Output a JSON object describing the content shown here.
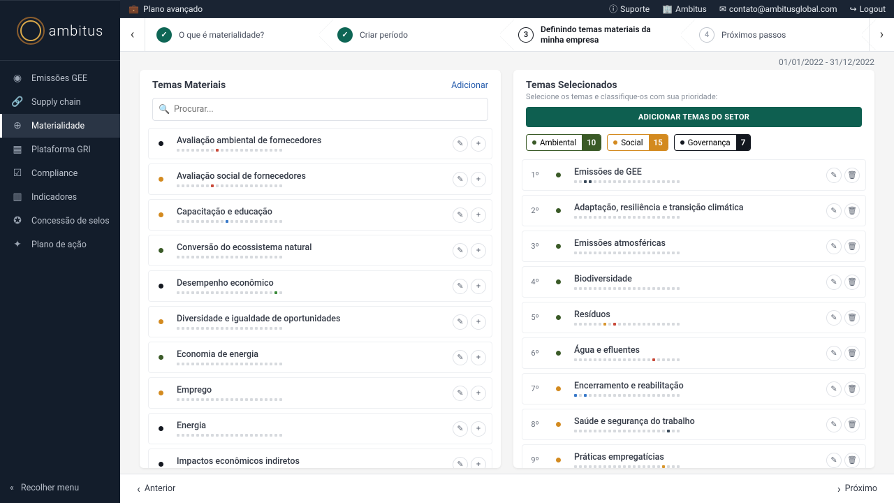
{
  "topbar": {
    "plan": "Plano avançado",
    "support": "Suporte",
    "brand": "Ambitus",
    "email": "contato@ambitusglobal.com",
    "logout": "Logout"
  },
  "logo_text": "ambitus",
  "nav": {
    "items": [
      {
        "label": "Emissões GEE"
      },
      {
        "label": "Supply chain"
      },
      {
        "label": "Materialidade"
      },
      {
        "label": "Plataforma GRI"
      },
      {
        "label": "Compliance"
      },
      {
        "label": "Indicadores"
      },
      {
        "label": "Concessão de selos"
      },
      {
        "label": "Plano de ação"
      }
    ],
    "collapse": "Recolher menu"
  },
  "stepper": {
    "s1": "O que é materialidade?",
    "s2": "Criar período",
    "s3": "Definindo temas materiais da minha empresa",
    "s4": "Próximos passos",
    "n3": "3",
    "n4": "4"
  },
  "date_range": "01/01/2022 - 31/12/2022",
  "left": {
    "title": "Temas Materiais",
    "add": "Adicionar",
    "search_placeholder": "Procurar...",
    "items": [
      {
        "cat": "gov",
        "name": "Avaliação ambiental de fornecedores"
      },
      {
        "cat": "soc",
        "name": "Avaliação social de fornecedores"
      },
      {
        "cat": "soc",
        "name": "Capacitação e educação"
      },
      {
        "cat": "env",
        "name": "Conversão do ecossistema natural"
      },
      {
        "cat": "gov",
        "name": "Desempenho econômico"
      },
      {
        "cat": "soc",
        "name": "Diversidade e igualdade de oportunidades"
      },
      {
        "cat": "env",
        "name": "Economia de energia"
      },
      {
        "cat": "soc",
        "name": "Emprego"
      },
      {
        "cat": "gov",
        "name": "Energia"
      },
      {
        "cat": "gov",
        "name": "Impactos econômicos indiretos"
      }
    ]
  },
  "right": {
    "title": "Temas Selecionados",
    "subtitle": "Selecione os temas e classifique-os com sua prioridade:",
    "sector_btn": "ADICIONAR TEMAS DO SETOR",
    "tags": {
      "env_label": "Ambiental",
      "env_count": "10",
      "soc_label": "Social",
      "soc_count": "15",
      "gov_label": "Governança",
      "gov_count": "7"
    },
    "items": [
      {
        "rank": "1º",
        "cat": "env",
        "name": "Emissões de GEE"
      },
      {
        "rank": "2º",
        "cat": "env",
        "name": "Adaptação, resiliência e transição climática"
      },
      {
        "rank": "3º",
        "cat": "env",
        "name": "Emissões atmosféricas"
      },
      {
        "rank": "4º",
        "cat": "env",
        "name": "Biodiversidade"
      },
      {
        "rank": "5º",
        "cat": "env",
        "name": "Resíduos"
      },
      {
        "rank": "6º",
        "cat": "env",
        "name": "Água e efluentes"
      },
      {
        "rank": "7º",
        "cat": "soc",
        "name": "Encerramento e reabilitação"
      },
      {
        "rank": "8º",
        "cat": "soc",
        "name": "Saúde e segurança do trabalho"
      },
      {
        "rank": "9º",
        "cat": "soc",
        "name": "Práticas empregatícias"
      }
    ]
  },
  "footer": {
    "prev": "Anterior",
    "next": "Próximo"
  }
}
